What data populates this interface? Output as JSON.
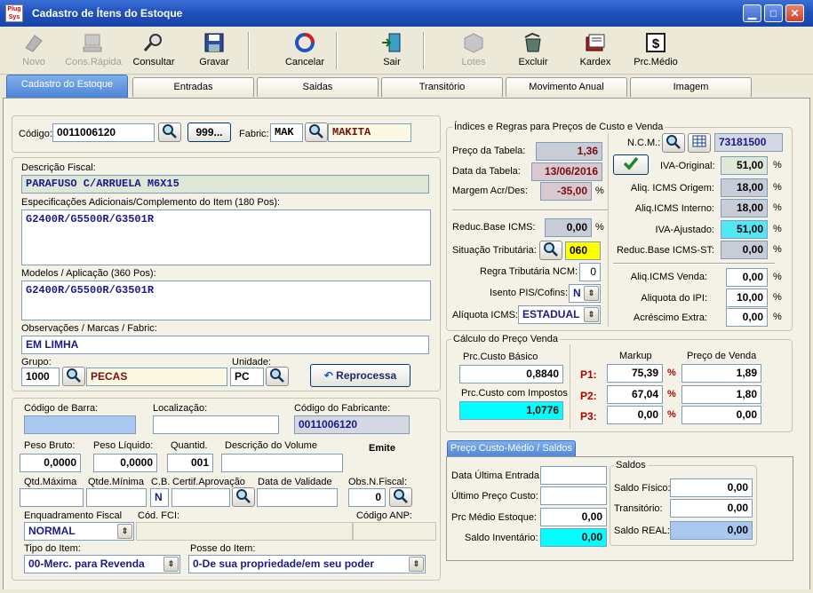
{
  "window": {
    "title": "Cadastro de Ítens do Estoque",
    "icon_text": "Plug Sys"
  },
  "toolbar": {
    "novo": "Novo",
    "cons_rapida": "Cons.Rápida",
    "consultar": "Consultar",
    "gravar": "Gravar",
    "cancelar": "Cancelar",
    "sair": "Sair",
    "lotes": "Lotes",
    "excluir": "Excluir",
    "kardex": "Kardex",
    "prc_medio": "Prc.Médio"
  },
  "tabs": [
    "Cadastro do Estoque",
    "Entradas",
    "Saidas",
    "Transitório",
    "Movimento Anual",
    "Imagem"
  ],
  "header": {
    "codigo_label": "Código:",
    "codigo": "0011006120",
    "btn_999": "999...",
    "fabric_label": "Fabric:",
    "fabric_code": "MAK",
    "fabric_name": "MAKITA"
  },
  "desc": {
    "fiscal_label": "Descrição Fiscal:",
    "fiscal": "PARAFUSO C/ARRUELA M6X15",
    "espec_label": "Especificações Adicionais/Complemento do Item (180 Pos):",
    "espec": "G2400R/G5500R/G3501R",
    "modelos_label": "Modelos / Aplicação (360 Pos):",
    "modelos": "G2400R/G5500R/G3501R",
    "obs_label": "Observações / Marcas / Fabric:",
    "obs": "EM LIMHA",
    "grupo_label": "Grupo:",
    "grupo_code": "1000",
    "grupo_name": "PECAS",
    "unidade_label": "Unidade:",
    "unidade": "PC",
    "reprocessa": "Reprocessa"
  },
  "misc": {
    "cod_barra_label": "Código de Barra:",
    "cod_barra": "",
    "localizacao_label": "Localização:",
    "localizacao": "",
    "cod_fabricante_label": "Código do Fabricante:",
    "cod_fabricante": "0011006120",
    "peso_bruto_label": "Peso Bruto:",
    "peso_bruto": "0,0000",
    "peso_liquido_label": "Peso Líquido:",
    "peso_liquido": "0,0000",
    "quantid_label": "Quantid.",
    "quantid": "001",
    "desc_volume_label": "Descrição do Volume",
    "emite_label": "Emite",
    "qtd_max_label": "Qtd.Máxima",
    "qtd_min_label": "Qtde.Mínima",
    "cb_label": "C.B.",
    "cb_value": "N",
    "certif_label": "Certif.Aprovação",
    "data_validade_label": "Data de Validade",
    "obs_nfiscal_label": "Obs.N.Fiscal:",
    "obs_nfiscal": "0",
    "enquadramento_label": "Enquadramento Fiscal",
    "enquadramento": "NORMAL",
    "cod_fci_label": "Cód. FCI:",
    "cod_anp_label": "Código ANP:",
    "tipo_item_label": "Tipo do Item:",
    "tipo_item": "00-Merc. para Revenda",
    "posse_label": "Posse do Item:",
    "posse": "0-De sua propriedade/em seu poder"
  },
  "indices": {
    "title": "Índices e Regras para Preços de Custo e Venda",
    "preco_tabela_label": "Preço da Tabela:",
    "preco_tabela": "1,36",
    "data_tabela_label": "Data da Tabela:",
    "data_tabela": "13/06/2016",
    "margem_label": "Margem Acr/Des:",
    "margem": "-35,00",
    "reduc_base_label": "Reduc.Base ICMS:",
    "reduc_base": "0,00",
    "situacao_label": "Situação Tributária:",
    "situacao": "060",
    "regra_ncm_label": "Regra Tributária NCM:",
    "regra_ncm": "0",
    "isento_label": "Isento PIS/Cofins:",
    "isento": "N",
    "aliquota_icms_label": "Alíquota ICMS:",
    "aliquota_icms": "ESTADUAL",
    "ncm_label": "N.C.M.:",
    "ncm": "73181500",
    "iva_original_label": "IVA-Original:",
    "iva_original": "51,00",
    "aliq_origem_label": "Aliq. ICMS Origem:",
    "aliq_origem": "18,00",
    "aliq_interno_label": "Aliq.ICMS Interno:",
    "aliq_interno": "18,00",
    "iva_ajustado_label": "IVA-Ajustado:",
    "iva_ajustado": "51,00",
    "reduc_st_label": "Reduc.Base ICMS-ST:",
    "reduc_st": "0,00",
    "aliq_venda_label": "Aliq.ICMS Venda:",
    "aliq_venda": "0,00",
    "aliquota_ipi_label": "Aliquota do IPI:",
    "aliquota_ipi": "10,00",
    "acrescimo_label": "Acréscimo Extra:",
    "acrescimo": "0,00",
    "pct": "%"
  },
  "calculo": {
    "title": "Cálculo do Preço Venda",
    "custo_basico_label": "Prc.Custo Básico",
    "custo_basico": "0,8840",
    "custo_impostos_label": "Prc.Custo com Impostos",
    "custo_impostos": "1,0776",
    "markup_label": "Markup",
    "preco_venda_label": "Preço de Venda",
    "rows": [
      {
        "label": "P1:",
        "markup": "75,39",
        "preco": "1,89"
      },
      {
        "label": "P2:",
        "markup": "67,04",
        "preco": "1,80"
      },
      {
        "label": "P3:",
        "markup": "0,00",
        "preco": "0,00"
      }
    ]
  },
  "custo_medio": {
    "tab_label": "Preço Custo-Médio / Saldos",
    "data_ultima_label": "Data Última Entrada:",
    "data_ultima": "",
    "ultimo_preco_label": "Último Preço Custo:",
    "ultimo_preco": "",
    "prc_medio_label": "Prc Médio Estoque:",
    "prc_medio": "0,00",
    "saldo_inv_label": "Saldo Inventário:",
    "saldo_inv": "0,00",
    "saldos_title": "Saldos",
    "saldo_fisico_label": "Saldo Físico:",
    "saldo_fisico": "0,00",
    "transitorio_label": "Transitório:",
    "transitorio": "0,00",
    "saldo_real_label": "Saldo REAL:",
    "saldo_real": "0,00"
  },
  "colors": {
    "title_bar": "#1f4fb9",
    "active_tab": "#4d84d6",
    "cyan": "#00ffff",
    "yellow": "#ffff00"
  }
}
